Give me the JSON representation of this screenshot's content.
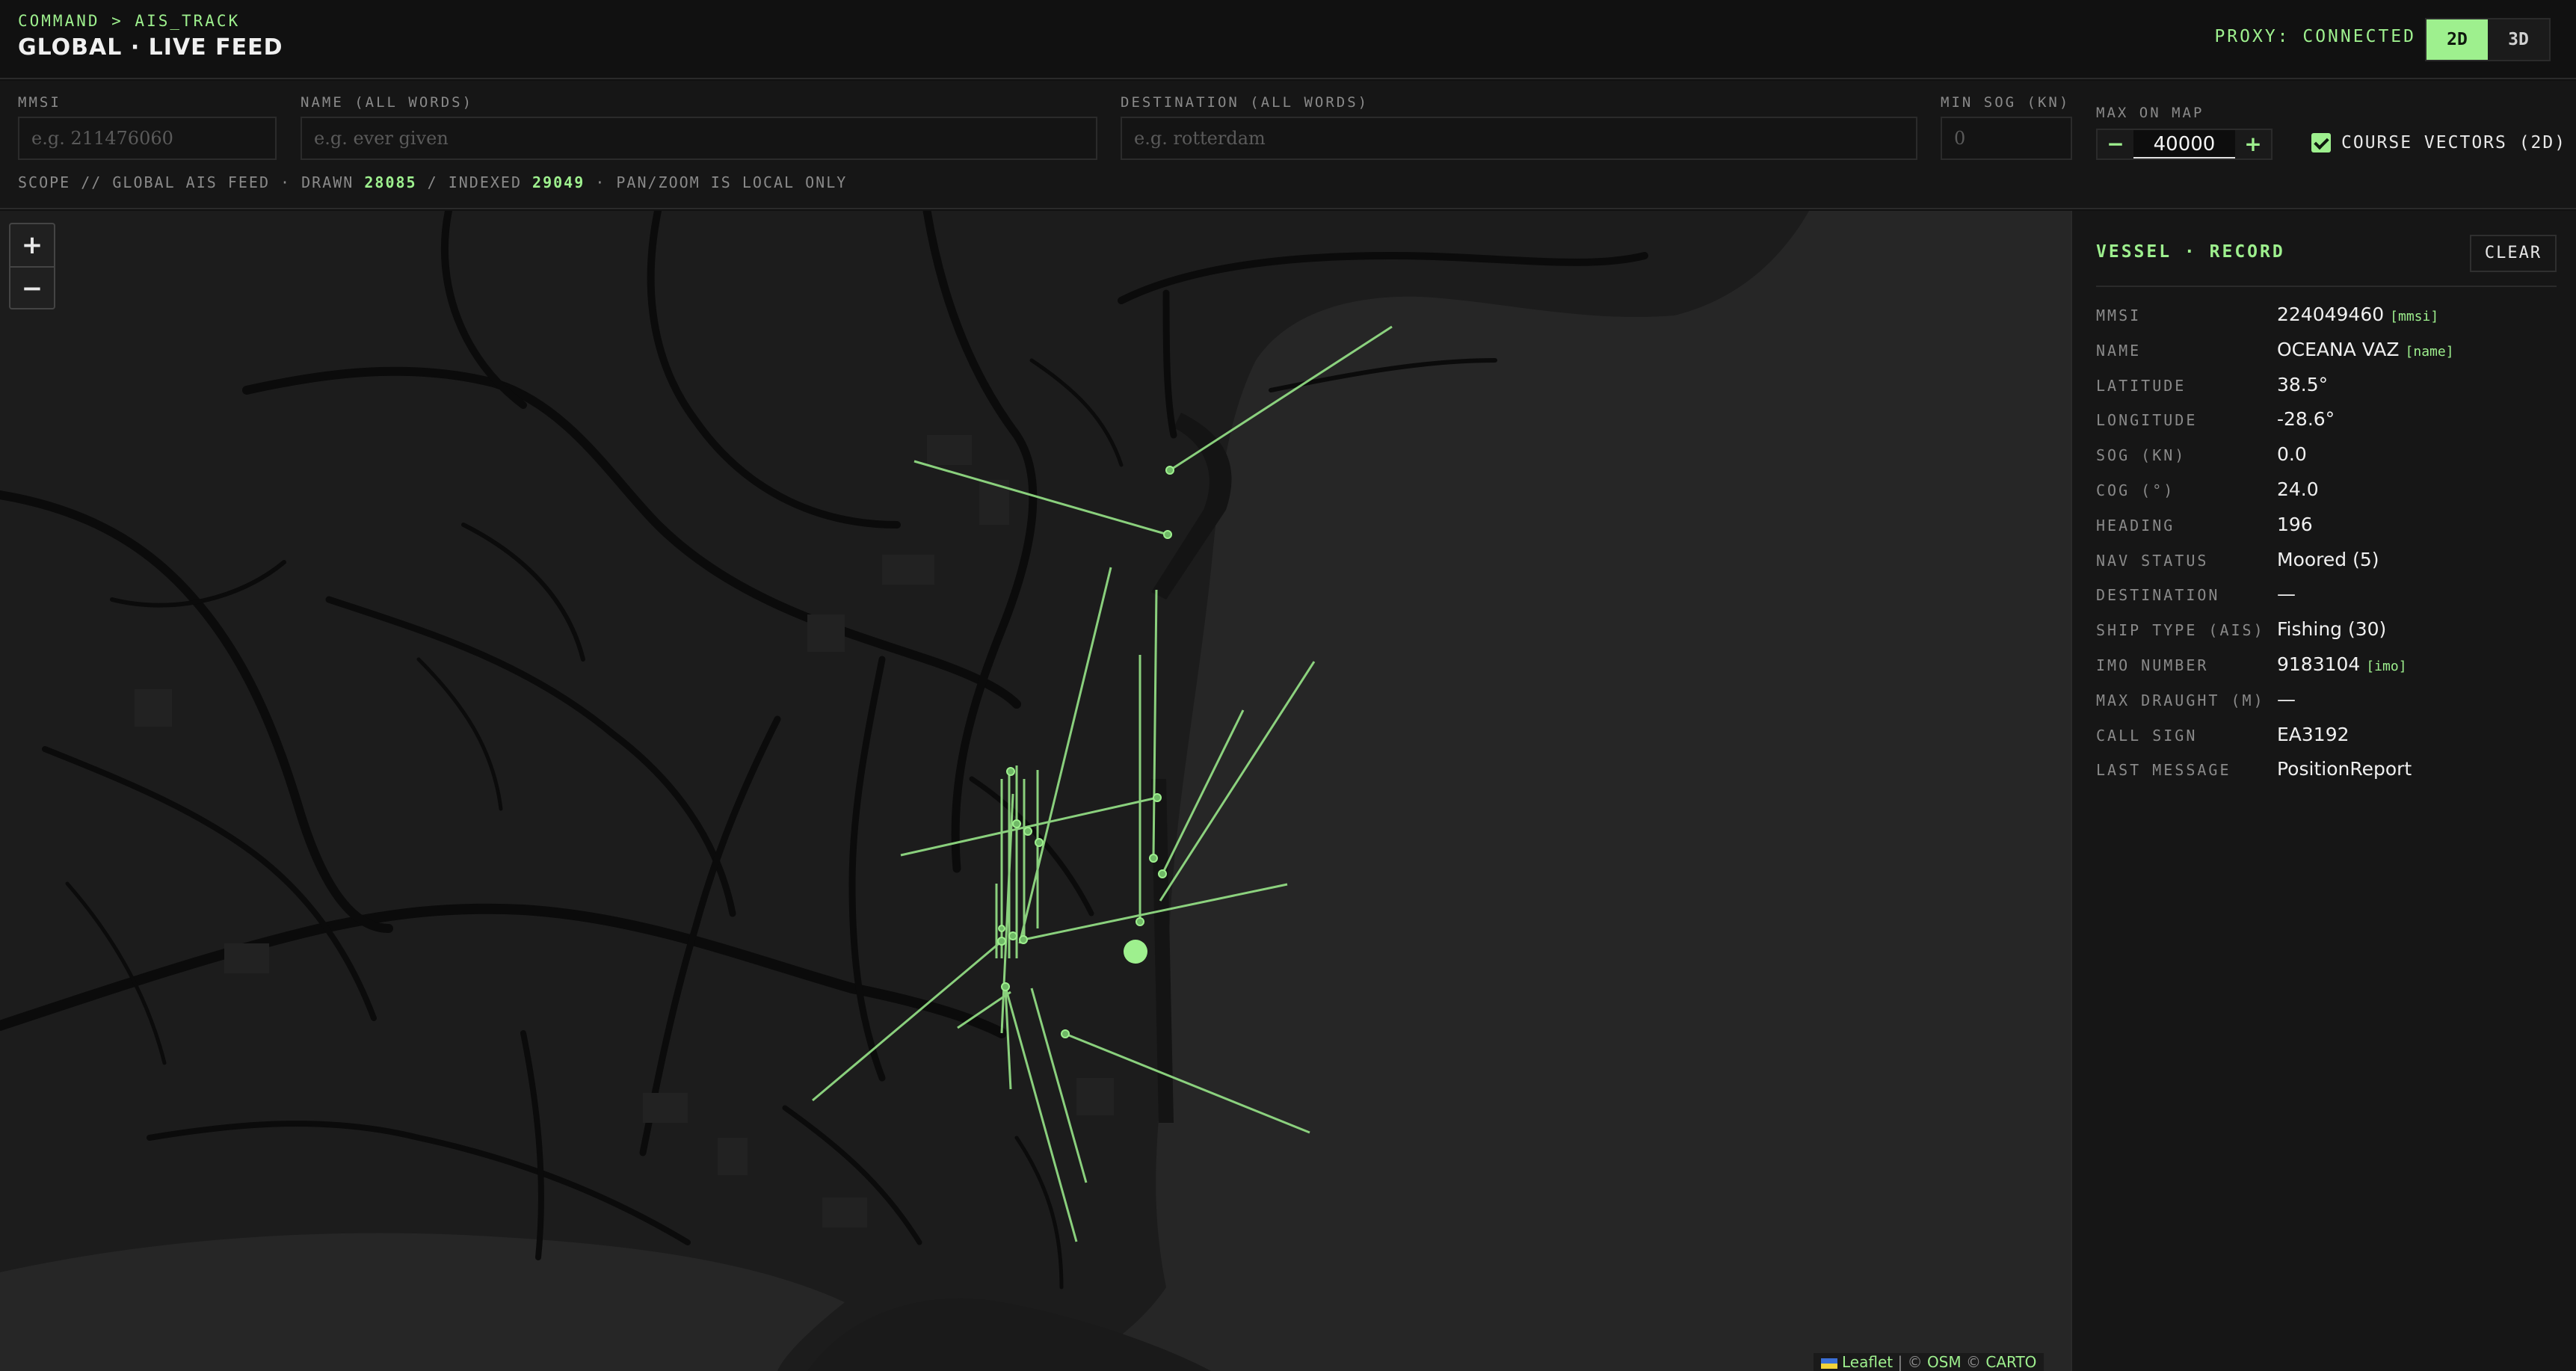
{
  "header": {
    "breadcrumb": "COMMAND > AIS_TRACK",
    "title": "GLOBAL · LIVE FEED",
    "proxy_status": "PROXY: CONNECTED",
    "view_modes": [
      {
        "label": "2D",
        "active": true
      },
      {
        "label": "3D",
        "active": false
      }
    ]
  },
  "filters": {
    "mmsi": {
      "label": "MMSI",
      "placeholder": "e.g. 211476060"
    },
    "name": {
      "label": "NAME (ALL WORDS)",
      "placeholder": "e.g. ever given"
    },
    "destination": {
      "label": "DESTINATION (ALL WORDS)",
      "placeholder": "e.g. rotterdam"
    },
    "min_sog": {
      "label": "MIN SOG (KN)",
      "placeholder": "0"
    },
    "max_on_map": {
      "label": "MAX ON MAP",
      "value": "40000",
      "decrement": "−",
      "increment": "+"
    },
    "course_vectors": {
      "label": "COURSE VECTORS (2D)",
      "checked": true
    }
  },
  "scope": {
    "prefix": "SCOPE // GLOBAL AIS FEED · DRAWN",
    "drawn": "28085",
    "indexed_label": "/ INDEXED",
    "indexed": "29049",
    "suffix": "· PAN/ZOOM IS LOCAL ONLY"
  },
  "map": {
    "zoom_in": "+",
    "zoom_out": "−",
    "attribution": {
      "leaflet": "Leaflet",
      "sep": "|",
      "osm_prefix": "©",
      "osm": "OSM",
      "carto_prefix": "©",
      "carto": "CARTO"
    },
    "colors": {
      "land": "#1c1c1c",
      "water": "#262626",
      "road": "#0a0a0a",
      "vector": "#9ef08e"
    }
  },
  "panel": {
    "title": "VESSEL · RECORD",
    "clear_label": "CLEAR",
    "rows": [
      {
        "key": "MMSI",
        "value": "224049460",
        "tag": "[mmsi]"
      },
      {
        "key": "NAME",
        "value": "OCEANA VAZ",
        "tag": "[name]"
      },
      {
        "key": "LATITUDE",
        "value": "38.5°",
        "tag": ""
      },
      {
        "key": "LONGITUDE",
        "value": "-28.6°",
        "tag": ""
      },
      {
        "key": "SOG (KN)",
        "value": "0.0",
        "tag": ""
      },
      {
        "key": "COG (°)",
        "value": "24.0",
        "tag": ""
      },
      {
        "key": "HEADING",
        "value": "196",
        "tag": ""
      },
      {
        "key": "NAV STATUS",
        "value": "Moored (5)",
        "tag": ""
      },
      {
        "key": "DESTINATION",
        "value": "—",
        "tag": ""
      },
      {
        "key": "SHIP TYPE (AIS)",
        "value": "Fishing (30)",
        "tag": ""
      },
      {
        "key": "IMO NUMBER",
        "value": "9183104",
        "tag": "[imo]"
      },
      {
        "key": "MAX DRAUGHT (M)",
        "value": "—",
        "tag": ""
      },
      {
        "key": "CALL SIGN",
        "value": "EA3192",
        "tag": ""
      },
      {
        "key": "LAST MESSAGE",
        "value": "PositionReport",
        "tag": ""
      }
    ]
  }
}
